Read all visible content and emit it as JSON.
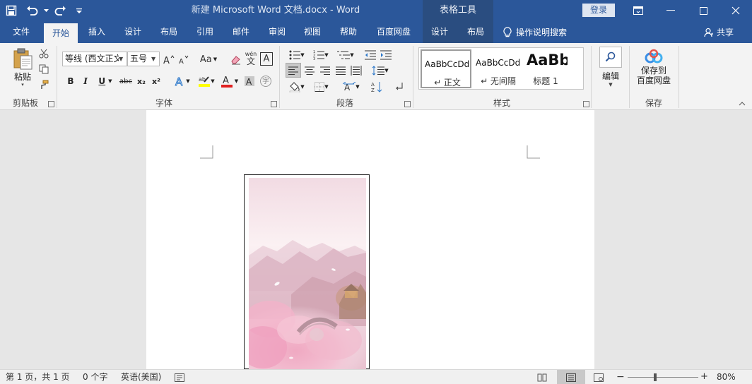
{
  "titlebar": {
    "doc_title": "新建 Microsoft Word 文档.docx  -  Word",
    "context_tab_group": "表格工具",
    "login_label": "登录"
  },
  "tabs": [
    {
      "label": "文件"
    },
    {
      "label": "开始"
    },
    {
      "label": "插入"
    },
    {
      "label": "设计"
    },
    {
      "label": "布局"
    },
    {
      "label": "引用"
    },
    {
      "label": "邮件"
    },
    {
      "label": "审阅"
    },
    {
      "label": "视图"
    },
    {
      "label": "帮助"
    },
    {
      "label": "百度网盘"
    },
    {
      "label": "设计"
    },
    {
      "label": "布局"
    }
  ],
  "tellme_label": "操作说明搜索",
  "share_label": "共享",
  "ribbon": {
    "clipboard": {
      "paste_label": "粘贴",
      "group_label": "剪贴板"
    },
    "font": {
      "font_name": "等线 (西文正文)",
      "font_size": "五号",
      "change_case": "Aa",
      "phonetic_top": "wén",
      "phonetic_bottom": "文",
      "border_char": "A",
      "bold": "B",
      "italic": "I",
      "underline": "U",
      "strike": "abc",
      "subscript": "x₂",
      "superscript": "x²",
      "enclose_char": "字",
      "group_label": "字体"
    },
    "paragraph": {
      "group_label": "段落"
    },
    "styles": {
      "items": [
        {
          "sample": "AaBbCcDd",
          "name": "↵ 正文"
        },
        {
          "sample": "AaBbCcDd",
          "name": "↵ 无间隔"
        },
        {
          "sample": "AaBb",
          "name": "标题 1"
        }
      ],
      "group_label": "样式"
    },
    "edit": {
      "label": "编辑"
    },
    "save": {
      "label_line1": "保存到",
      "label_line2": "百度网盘",
      "group_label": "保存"
    }
  },
  "statusbar": {
    "page_info": "第 1 页，共 1 页",
    "word_count": "0 个字",
    "language": "英语(美国)",
    "zoom_level": "80%"
  },
  "colors": {
    "word_blue": "#2b579a",
    "context_blue": "#2a4d80",
    "ribbon_bg": "#f3f3f3",
    "highlight_yellow": "#ffff00",
    "font_red": "#e02020"
  },
  "icons": {
    "save": "save-icon",
    "undo": "undo-icon",
    "redo": "redo-icon",
    "paste": "paste-icon",
    "cut": "scissors-icon",
    "copy": "copy-icon",
    "format_painter": "format-painter-icon",
    "search": "magnifier-icon",
    "baidu": "baidu-netdisk-icon",
    "lightbulb": "lightbulb-icon",
    "person": "person-icon"
  }
}
